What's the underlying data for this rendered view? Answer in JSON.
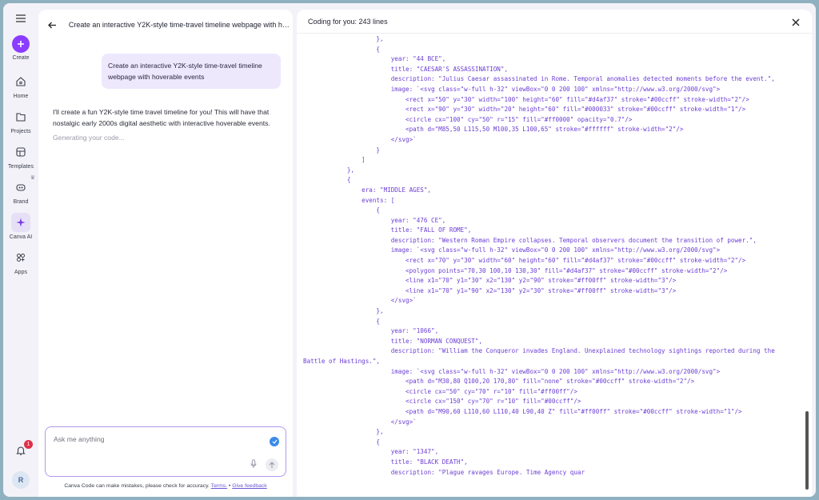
{
  "rail": {
    "create_label": "Create",
    "items": [
      {
        "label": "Home",
        "icon": "home-icon"
      },
      {
        "label": "Projects",
        "icon": "folder-icon"
      },
      {
        "label": "Templates",
        "icon": "templates-icon"
      },
      {
        "label": "Brand",
        "icon": "brand-icon"
      },
      {
        "label": "Canva AI",
        "icon": "sparkle-icon"
      },
      {
        "label": "Apps",
        "icon": "apps-icon"
      }
    ],
    "notification_count": "1",
    "avatar_initial": "R",
    "accent": "#8b3dff"
  },
  "chat": {
    "title": "Create an interactive Y2K-style time-travel timeline webpage with hoverable events",
    "user_message": "Create an interactive Y2K-style time-travel timeline webpage with hoverable events",
    "assistant_reply": "I'll create a fun Y2K-style time travel timeline for you! This will have that nostalgic early 2000s digital aesthetic with interactive hoverable events.",
    "status": "Generating your code...",
    "input_placeholder": "Ask me anything",
    "disclaimer_text": "Canva Code can make mistakes, please check for accuracy.",
    "terms_label": "Terms.",
    "separator": "•",
    "feedback_label": "Give feedback"
  },
  "code": {
    "title": "Coding for you: 243 lines",
    "lines": [
      "                    },",
      "                    {",
      "                        year: \"44 BCE\",",
      "                        title: \"CAESAR'S ASSASSINATION\",",
      "                        description: \"Julius Caesar assassinated in Rome. Temporal anomalies detected moments before the event.\",",
      "                        image: `<svg class=\"w-full h-32\" viewBox=\"0 0 200 100\" xmlns=\"http://www.w3.org/2000/svg\">",
      "                            <rect x=\"50\" y=\"30\" width=\"100\" height=\"60\" fill=\"#d4af37\" stroke=\"#00ccff\" stroke-width=\"2\"/>",
      "                            <rect x=\"90\" y=\"30\" width=\"20\" height=\"60\" fill=\"#000033\" stroke=\"#00ccff\" stroke-width=\"1\"/>",
      "                            <circle cx=\"100\" cy=\"50\" r=\"15\" fill=\"#ff0000\" opacity=\"0.7\"/>",
      "                            <path d=\"M85,50 L115,50 M100,35 L100,65\" stroke=\"#ffffff\" stroke-width=\"2\"/>",
      "                        </svg>`",
      "                    }",
      "                ]",
      "            },",
      "            {",
      "                era: \"MIDDLE AGES\",",
      "                events: [",
      "                    {",
      "                        year: \"476 CE\",",
      "                        title: \"FALL OF ROME\",",
      "                        description: \"Western Roman Empire collapses. Temporal observers document the transition of power.\",",
      "                        image: `<svg class=\"w-full h-32\" viewBox=\"0 0 200 100\" xmlns=\"http://www.w3.org/2000/svg\">",
      "                            <rect x=\"70\" y=\"30\" width=\"60\" height=\"60\" fill=\"#d4af37\" stroke=\"#00ccff\" stroke-width=\"2\"/>",
      "                            <polygon points=\"70,30 100,10 130,30\" fill=\"#d4af37\" stroke=\"#00ccff\" stroke-width=\"2\"/>",
      "                            <line x1=\"70\" y1=\"30\" x2=\"130\" y2=\"90\" stroke=\"#ff00ff\" stroke-width=\"3\"/>",
      "                            <line x1=\"70\" y1=\"90\" x2=\"130\" y2=\"30\" stroke=\"#ff00ff\" stroke-width=\"3\"/>",
      "                        </svg>`",
      "                    },",
      "                    {",
      "                        year: \"1066\",",
      "                        title: \"NORMAN CONQUEST\",",
      "                        description: \"William the Conqueror invades England. Unexplained technology sightings reported during the",
      "Battle of Hastings.\",",
      "                        image: `<svg class=\"w-full h-32\" viewBox=\"0 0 200 100\" xmlns=\"http://www.w3.org/2000/svg\">",
      "                            <path d=\"M30,80 Q100,20 170,80\" fill=\"none\" stroke=\"#00ccff\" stroke-width=\"2\"/>",
      "                            <circle cx=\"50\" cy=\"70\" r=\"10\" fill=\"#ff00ff\"/>",
      "                            <circle cx=\"150\" cy=\"70\" r=\"10\" fill=\"#00ccff\"/>",
      "                            <path d=\"M90,60 L110,60 L110,40 L90,40 Z\" fill=\"#ff00ff\" stroke=\"#00ccff\" stroke-width=\"1\"/>",
      "                        </svg>`",
      "                    },",
      "                    {",
      "                        year: \"1347\",",
      "                        title: \"BLACK DEATH\",",
      "                        description: \"Plague ravages Europe. Time Agency quar"
    ]
  }
}
